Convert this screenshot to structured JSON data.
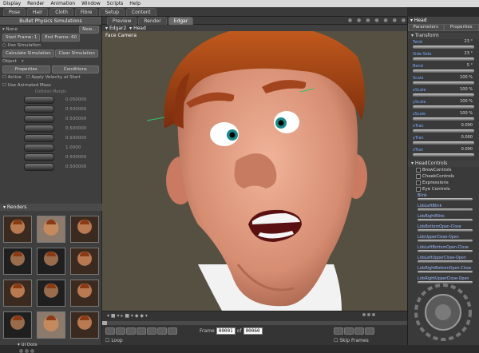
{
  "menu": [
    "Display",
    "Render",
    "Animation",
    "Window",
    "Scripts",
    "Help"
  ],
  "room_tabs": [
    "Pose",
    "Hair",
    "Cloth",
    "Fibre",
    "Setup",
    "Content"
  ],
  "left_panel": {
    "title": "Bullet Physics Simulations",
    "new_button": "New...",
    "object_label": "None",
    "sim_rows": [
      "Start Frame: 1",
      "End Frame: 60",
      "Use Simulation",
      "Calculate Simulation",
      "Clear Simulation"
    ],
    "object_label2": "Object",
    "subtabs": [
      "Properties",
      "Conditions"
    ],
    "checks": [
      "Active",
      "Apply Velocity at Start",
      "Use Animated Mass"
    ],
    "dials": [
      {
        "label": "Collision Margin",
        "value": "0.050000"
      },
      {
        "label": "",
        "value": "0.500000"
      },
      {
        "label": "",
        "value": "0.500000"
      },
      {
        "label": "",
        "value": "0.500000"
      },
      {
        "label": "",
        "value": "0.500000"
      },
      {
        "label": "",
        "value": "1.0000"
      },
      {
        "label": "",
        "value": "0.500000"
      },
      {
        "label": "",
        "value": "0.500000"
      }
    ],
    "renders_title": "Renders",
    "ui_dots": "UI Dots"
  },
  "viewport": {
    "tabs": [
      "Preview",
      "Render",
      "Edgar"
    ],
    "camera_selector": "Edgar2",
    "figure_selector": "Head",
    "camera_label": "Face Camera",
    "frame_label": "Frame",
    "frame_current": "00001",
    "frame_of": "of",
    "frame_total": "00060",
    "loop_label": "Loop",
    "skip_frames_label": "Skip Frames"
  },
  "right_panel": {
    "title": "Head",
    "tabs": [
      "Parameters",
      "Properties"
    ],
    "transform_label": "Transform",
    "params": [
      {
        "label": "Twist",
        "value": "23 °"
      },
      {
        "label": "Side-Side",
        "value": "23 °"
      },
      {
        "label": "Bend",
        "value": "5 °"
      },
      {
        "label": "Scale",
        "value": "100 %"
      },
      {
        "label": "xScale",
        "value": "100 %"
      },
      {
        "label": "yScale",
        "value": "100 %"
      },
      {
        "label": "zScale",
        "value": "100 %"
      },
      {
        "label": "xTran",
        "value": "0.000"
      },
      {
        "label": "yTran",
        "value": "0.000"
      },
      {
        "label": "zTran",
        "value": "0.000"
      }
    ],
    "controls_label": "HeadControls",
    "controls": [
      "BrowControls",
      "CheekControls",
      "Expressions",
      "Eye Controls"
    ],
    "lid_params": [
      "Blink",
      "LidsLeftBlink",
      "LidsRightBlink",
      "LidsBottomOpen-Close",
      "LidsUpperClose-Open",
      "LidsLeftBottomOpen-Close",
      "LidsLeftUpperClose-Open",
      "LidsRightBottomOpen-Close",
      "LidsRightUpperClose-Open"
    ]
  },
  "colors": {
    "accent": "#77aaff",
    "viewport_bg": "#565043",
    "hair": "#b24c14",
    "skin": "#e6a48a"
  }
}
